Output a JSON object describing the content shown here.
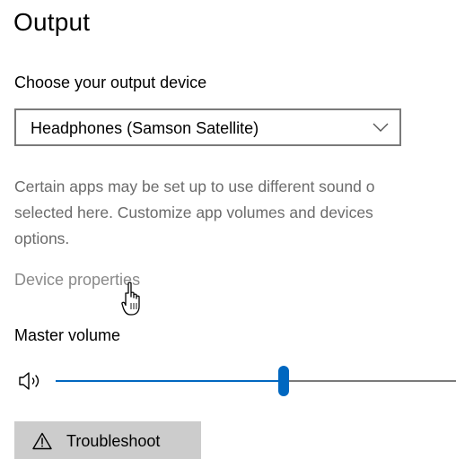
{
  "output": {
    "title": "Output",
    "device_label": "Choose your output device",
    "device_dropdown": {
      "selected": "Headphones (Samson Satellite)",
      "chevron_icon": "chevron-down-icon"
    },
    "help_text_lines": [
      "Certain apps may be set up to use different sound o",
      "selected here. Customize app volumes and devices",
      "options."
    ],
    "device_properties_link": "Device properties",
    "master_volume": {
      "label": "Master volume",
      "icon": "speaker-icon",
      "level": 0.57
    },
    "troubleshoot_button": {
      "label": "Troubleshoot",
      "icon": "warning-icon"
    }
  },
  "colors": {
    "accent": "#0067c0",
    "secondary_text": "#6b6b6b",
    "link_text": "#8a8a8a",
    "button_bg": "#cccccc"
  }
}
